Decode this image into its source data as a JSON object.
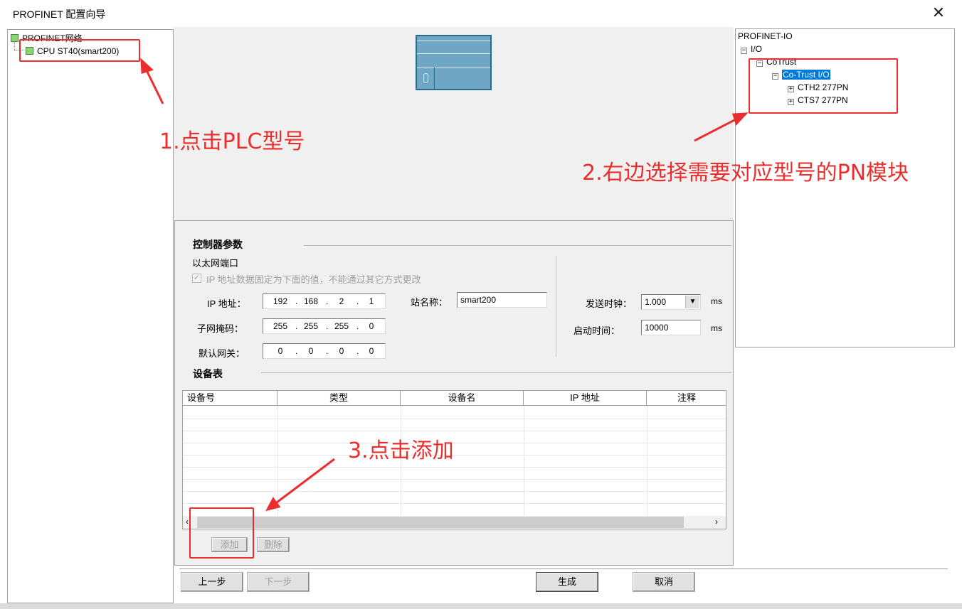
{
  "window": {
    "title": "PROFINET 配置向导",
    "close_symbol": "✕"
  },
  "left_tree": {
    "root": "PROFINET网络",
    "child": "CPU ST40(smart200)"
  },
  "controller": {
    "section_title": "控制器参数",
    "ethernet_label": "以太网端口",
    "fixed_ip_checkbox": "IP 地址数据固定为下面的值，不能通过其它方式更改",
    "ip_label": "IP 地址：",
    "ip": [
      "192",
      "168",
      "2",
      "1"
    ],
    "mask_label": "子网掩码：",
    "mask": [
      "255",
      "255",
      "255",
      "0"
    ],
    "gateway_label": "默认网关：",
    "gateway": [
      "0",
      "0",
      "0",
      "0"
    ],
    "station_label": "站名称：",
    "station_value": "smart200",
    "send_clock_label": "发送时钟：",
    "send_clock_value": "1.000",
    "send_clock_unit": "ms",
    "startup_label": "启动时间：",
    "startup_value": "10000",
    "startup_unit": "ms"
  },
  "device_table": {
    "section_title": "设备表",
    "columns": [
      "设备号",
      "类型",
      "设备名",
      "IP 地址",
      "注释"
    ],
    "add_button": "添加",
    "delete_button": "删除"
  },
  "right_tree": {
    "root": "PROFINET-IO",
    "io": "I/O",
    "vendor": "CoTrust",
    "group": "Co-Trust I/O",
    "modules": [
      "CTH2 277PN",
      "CTS7 277PN"
    ]
  },
  "footer": {
    "prev": "上一步",
    "next": "下一步",
    "generate": "生成",
    "cancel": "取消"
  },
  "annotations": {
    "step1": "1.点击PLC型号",
    "step2": "2.右边选择需要对应型号的PN模块",
    "step3": "3.点击添加",
    "color": "#ea2e2e"
  }
}
